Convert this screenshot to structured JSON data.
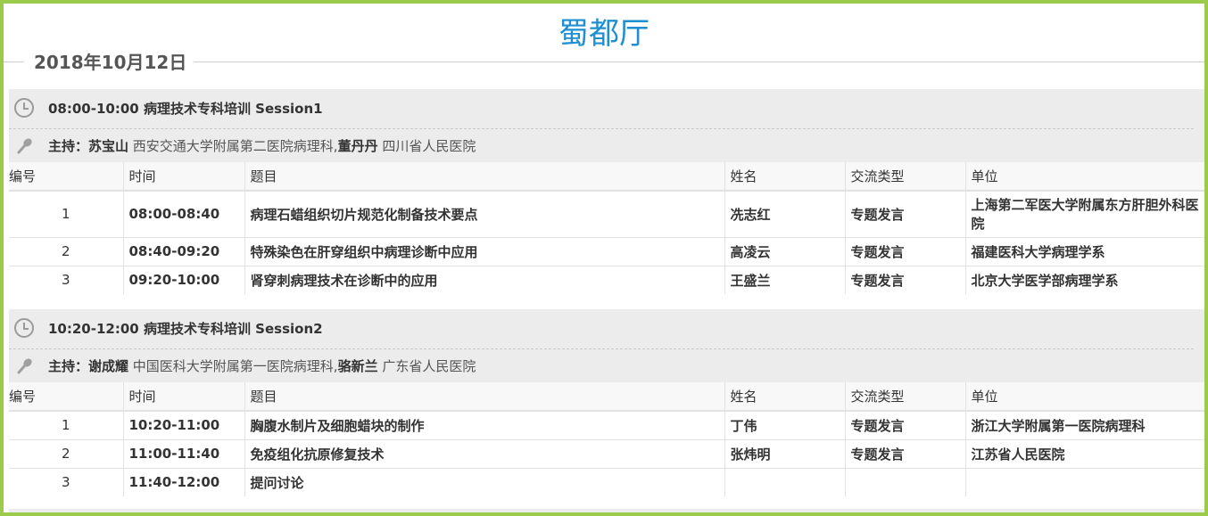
{
  "hall": "蜀都厅",
  "date": "2018年10月12日",
  "columns": [
    "编号",
    "时间",
    "题目",
    "姓名",
    "交流类型",
    "单位"
  ],
  "sessions": [
    {
      "time_title": "08:00-10:00 病理技术专科培训 Session1",
      "chair_label": "主持：",
      "chair1_name": "苏宝山",
      "chair1_unit": " 西安交通大学附属第二医院病理科,",
      "chair2_name": "董丹丹",
      "chair2_unit": " 四川省人民医院",
      "rows": [
        {
          "no": "1",
          "time": "08:00-08:40",
          "topic": "病理石蜡组织切片规范化制备技术要点",
          "name": "冼志红",
          "type": "专题发言",
          "unit": "上海第二军医大学附属东方肝胆外科医院"
        },
        {
          "no": "2",
          "time": "08:40-09:20",
          "topic": "特殊染色在肝穿组织中病理诊断中应用",
          "name": "高凌云",
          "type": "专题发言",
          "unit": "福建医科大学病理学系"
        },
        {
          "no": "3",
          "time": "09:20-10:00",
          "topic": "肾穿刺病理技术在诊断中的应用",
          "name": "王盛兰",
          "type": "专题发言",
          "unit": "北京大学医学部病理学系"
        }
      ]
    },
    {
      "time_title": "10:20-12:00 病理技术专科培训 Session2",
      "chair_label": "主持：",
      "chair1_name": "谢成耀",
      "chair1_unit": " 中国医科大学附属第一医院病理科,",
      "chair2_name": "骆新兰",
      "chair2_unit": " 广东省人民医院",
      "rows": [
        {
          "no": "1",
          "time": "10:20-11:00",
          "topic": "胸腹水制片及细胞蜡块的制作",
          "name": "丁伟",
          "type": "专题发言",
          "unit": "浙江大学附属第一医院病理科"
        },
        {
          "no": "2",
          "time": "11:00-11:40",
          "topic": "免疫组化抗原修复技术",
          "name": "张炜明",
          "type": "专题发言",
          "unit": "江苏省人民医院"
        },
        {
          "no": "3",
          "time": "11:40-12:00",
          "topic": "提问讨论",
          "name": "",
          "type": "",
          "unit": ""
        }
      ]
    }
  ]
}
